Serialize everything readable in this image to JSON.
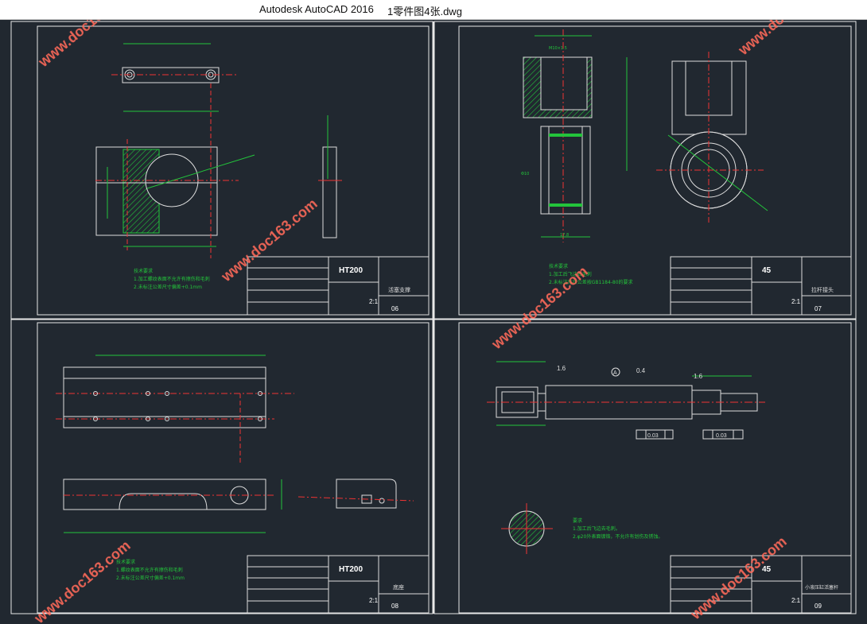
{
  "window": {
    "app_title": "Autodesk AutoCAD 2016",
    "file_title": "1零件图4张.dwg"
  },
  "watermark": "www.doc163.com",
  "sheets": [
    {
      "material": "HT200",
      "name": "活塞支撑",
      "number": "06",
      "scale": "2:1",
      "notes": [
        "技术要求",
        "1.加工螺纹表面不允许有擦伤和毛刺",
        "2.未标注公差尺寸偏差+0.1mm"
      ]
    },
    {
      "material": "45",
      "name": "拉杆接头",
      "number": "07",
      "scale": "2:1",
      "notes": [
        "技术要求",
        "1.加工后飞边去毛刺",
        "2.未标注形状公差按GB1184-80的要求"
      ]
    },
    {
      "material": "HT200",
      "name": "底座",
      "number": "08",
      "scale": "2:1",
      "notes": [
        "技术要求",
        "1.螺纹表面不允许有擦伤和毛刺",
        "2.未标注公差尺寸偏差+0.1mm"
      ]
    },
    {
      "material": "45",
      "name": "小液压缸活塞杆",
      "number": "09",
      "scale": "2:1",
      "notes": [
        "要求",
        "1.加工后飞边去毛刺。",
        "2.φ20外表面镀铬，不允许有划伤及锈蚀。"
      ]
    }
  ],
  "annotations": {
    "roughness_1": "1.6",
    "roughness_2": "0.4",
    "roughness_3": "1.6",
    "datum": "A",
    "tol_1": "0.03",
    "tol_2": "0.03"
  },
  "dims": {
    "m": "M10×1.5",
    "d": "Φ10",
    "w": "17.8"
  }
}
